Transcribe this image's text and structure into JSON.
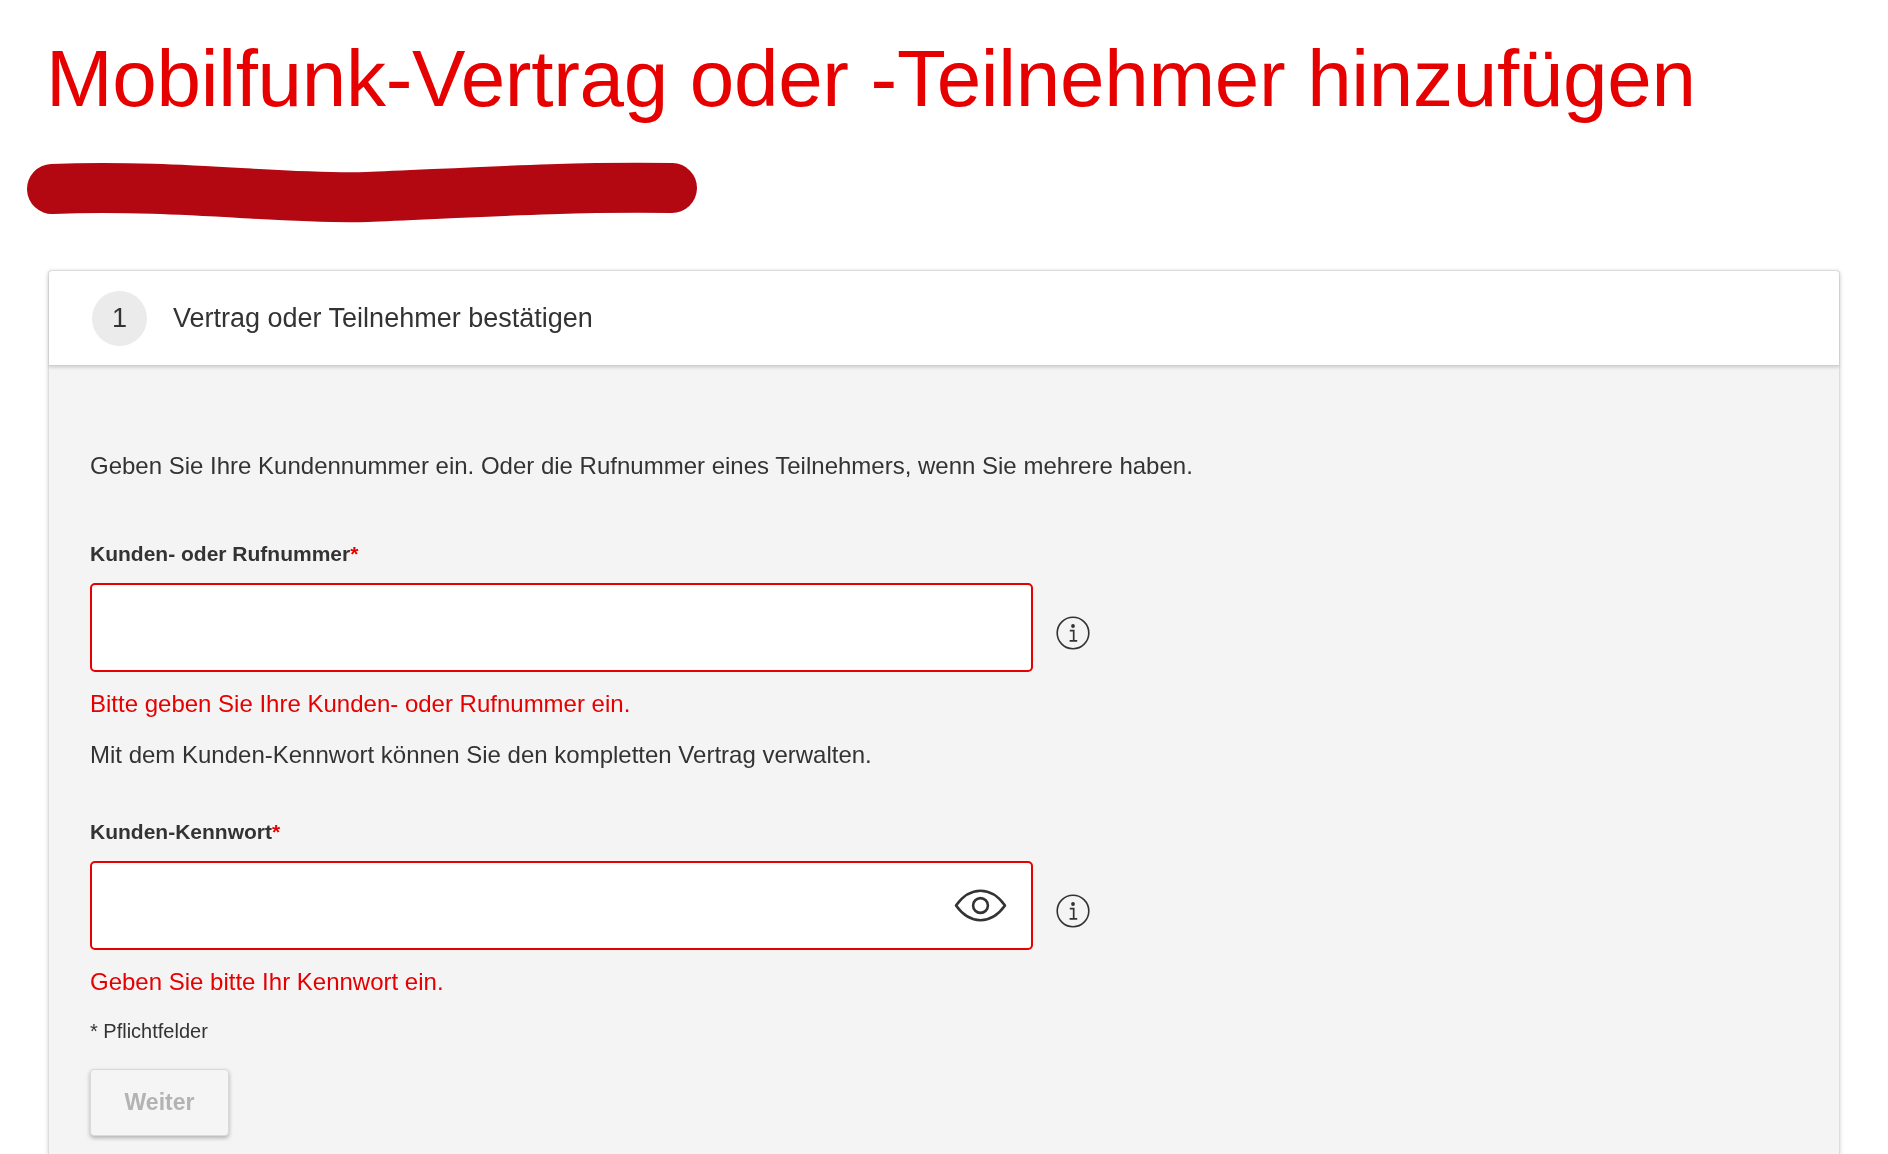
{
  "page_title": "Mobilfunk-Vertrag oder -Teilnehmer hinzufügen",
  "step": {
    "number": "1",
    "title": "Vertrag oder Teilnehmer bestätigen"
  },
  "form": {
    "fields": [
      {
        "kind": "text",
        "description": "Geben Sie Ihre Kundennummer ein. Oder die Rufnummer eines Teilnehmers, wenn Sie mehrere haben.",
        "label": "Kunden- oder Rufnummer",
        "required_mark": "*",
        "invalid": true,
        "error": "Bitte geben Sie Ihre Kunden- oder Rufnummer ein."
      },
      {
        "kind": "password",
        "description": "Mit dem Kunden-Kennwort können Sie den kompletten Vertrag verwalten.",
        "label": "Kunden-Kennwort",
        "required_mark": "*",
        "invalid": true,
        "error": "Geben Sie bitte Ihr Kennwort ein."
      }
    ],
    "required_note": "* Pflichtfelder",
    "submit": {
      "label": "Weiter",
      "disabled": true
    }
  }
}
